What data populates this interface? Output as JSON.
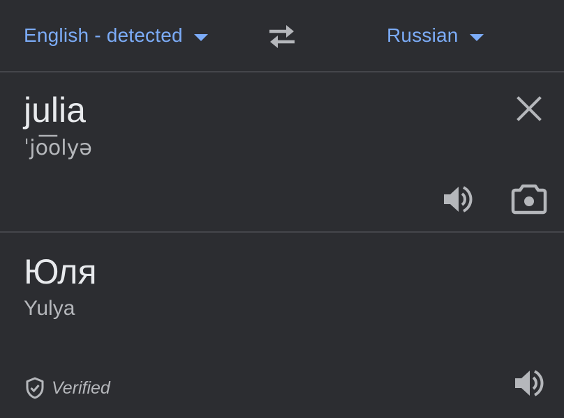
{
  "header": {
    "source_language": "English - detected",
    "target_language": "Russian"
  },
  "source": {
    "text": "julia",
    "phonetic": "ˈjo͞olyə"
  },
  "translation": {
    "text": "Юля",
    "transliteration": "Yulya",
    "verified_label": "Verified"
  },
  "icons": {
    "swap": "swap-arrows-icon",
    "clear": "close-icon",
    "speak": "speaker-icon",
    "camera": "camera-icon",
    "verified": "shield-check-icon",
    "dropdown": "caret-down-icon"
  },
  "colors": {
    "background": "#2c2d31",
    "accent": "#7cacf8",
    "primary_text": "#e8eaed",
    "secondary_text": "#b5b7bb",
    "icon": "#b5b7bb",
    "divider": "#45464b"
  }
}
